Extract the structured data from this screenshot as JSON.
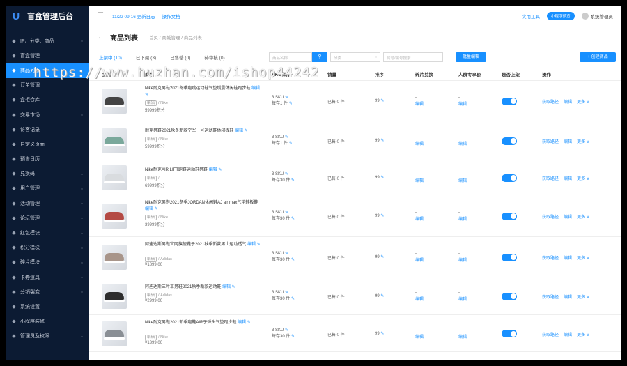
{
  "app": {
    "title": "盲盒管理后台"
  },
  "sidebar": {
    "items": [
      {
        "label": "IP、分类、商品",
        "icon": "tag-icon",
        "arrow": true
      },
      {
        "label": "盲盒管理",
        "icon": "box-icon",
        "arrow": false
      },
      {
        "label": "商品列表",
        "icon": "list-icon",
        "arrow": false,
        "active": true
      },
      {
        "label": "订单管理",
        "icon": "order-icon",
        "arrow": false
      },
      {
        "label": "盒柜仓库",
        "icon": "warehouse-icon",
        "arrow": false
      },
      {
        "label": "交易市场",
        "icon": "market-icon",
        "arrow": true
      },
      {
        "label": "访客记录",
        "icon": "visitor-icon",
        "arrow": false
      },
      {
        "label": "自定义页面",
        "icon": "page-icon",
        "arrow": false
      },
      {
        "label": "预售日历",
        "icon": "calendar-icon",
        "arrow": false
      },
      {
        "label": "兑换码",
        "icon": "code-icon",
        "arrow": true
      },
      {
        "label": "用户管理",
        "icon": "user-icon",
        "arrow": true
      },
      {
        "label": "活动管理",
        "icon": "activity-icon",
        "arrow": true
      },
      {
        "label": "论坛管理",
        "icon": "forum-icon",
        "arrow": true
      },
      {
        "label": "红包模块",
        "icon": "redpacket-icon",
        "arrow": true
      },
      {
        "label": "积分模块",
        "icon": "points-icon",
        "arrow": true
      },
      {
        "label": "碎片模块",
        "icon": "fragment-icon",
        "arrow": true
      },
      {
        "label": "卡券道具",
        "icon": "coupon-icon",
        "arrow": true
      },
      {
        "label": "分销裂变",
        "icon": "share-icon",
        "arrow": true
      },
      {
        "label": "系统设置",
        "icon": "settings-icon",
        "arrow": false
      },
      {
        "label": "小程序装修",
        "icon": "miniapp-icon",
        "arrow": false
      },
      {
        "label": "管理员及权限",
        "icon": "admin-icon",
        "arrow": true
      }
    ]
  },
  "topbar": {
    "time": "11/22 09:16 更新日志",
    "doc": "操作文档",
    "tools": "实用工具",
    "mini_program": "小程序预览",
    "user": "系统管理员"
  },
  "page": {
    "title": "商品列表",
    "breadcrumb": "首页 / 商城管理 / 商品列表"
  },
  "toolbar": {
    "tabs": [
      "上架中 (10)",
      "已下架 (3)",
      "已售罄 (0)",
      "待审核 (0)"
    ],
    "search_placeholder": "商品名称",
    "category_placeholder": "分类",
    "code_placeholder": "货号/编号搜索",
    "batch_label": "批量编辑",
    "create_label": "+ 创建商品"
  },
  "table": {
    "headers": [
      "主图",
      "商品",
      "SKU库存",
      "销量",
      "排序",
      "碎片兑换",
      "人群专享价",
      "是否上架",
      "操作"
    ],
    "rows": [
      {
        "name": "Nike耐克男鞋2021冬季跑跳运动鞋气垫缓震休闲鞋跑步鞋",
        "edit": "编辑",
        "tag": "Nike",
        "price": "59999积分",
        "sku": "3 SKU",
        "stock": "每存1 件",
        "sales": "已售 0 件",
        "sort": "99",
        "frag": "-",
        "frag_edit": "编辑",
        "pm": "-",
        "pm_edit": "编辑",
        "shoe": "#444"
      },
      {
        "name": "耐克男鞋2021秋冬新款空军一号运动鞋休闲板鞋",
        "edit": "编辑",
        "tag": "Nike",
        "price": "59999积分",
        "sku": "3 SKU",
        "stock": "每存1 件",
        "sales": "已售 0 件",
        "sort": "99",
        "frag": "-",
        "frag_edit": "编辑",
        "pm": "-",
        "pm_edit": "编辑",
        "shoe": "#7aa89b"
      },
      {
        "name": "Nike耐克AIR LIFT跑鞋运动鞋男鞋",
        "edit": "编辑",
        "tag": "",
        "price": "69999积分",
        "sku": "3 SKU",
        "stock": "每存30 件",
        "sales": "已售 0 件",
        "sort": "99",
        "frag": "-",
        "frag_edit": "编辑",
        "pm": "-",
        "pm_edit": "编辑",
        "shoe": "#d9dcdf"
      },
      {
        "name": "Nike耐克男鞋2021冬季JORDAN休闲鞋AJ air max气垫鞋板鞋",
        "edit": "编辑",
        "tag": "Nike",
        "price": "39999积分",
        "sku": "3 SKU",
        "stock": "每存30 件",
        "sales": "已售 0 件",
        "sort": "99",
        "frag": "-",
        "frag_edit": "编辑",
        "pm": "-",
        "pm_edit": "编辑",
        "shoe": "#b44a44"
      },
      {
        "name": "阿迪达斯男鞋官网旗舰鞋子2021秋季新款男士运动透气",
        "edit": "编辑",
        "tag": "Adidas",
        "price": "¥1899.00",
        "sku": "3 SKU",
        "stock": "每存30 件",
        "sales": "已售 0 件",
        "sort": "99",
        "frag": "-",
        "frag_edit": "编辑",
        "pm": "-",
        "pm_edit": "编辑",
        "shoe": "#a8958a"
      },
      {
        "name": "阿迪达斯三叶草男鞋2021秋季新款运动鞋",
        "edit": "编辑",
        "tag": "Adidas",
        "price": "¥2999.00",
        "sku": "3 SKU",
        "stock": "每存30 件",
        "sales": "已售 0 件",
        "sort": "99",
        "frag": "-",
        "frag_edit": "编辑",
        "pm": "-",
        "pm_edit": "编辑",
        "shoe": "#2d2d2d"
      },
      {
        "name": "Nike耐克男鞋2021新季跑鞋AIR子弹头气垫跑步鞋",
        "edit": "编辑",
        "tag": "Nike",
        "price": "¥1399.00",
        "sku": "3 SKU",
        "stock": "每存30 件",
        "sales": "已售 0 件",
        "sort": "99",
        "frag": "-",
        "frag_edit": "编辑",
        "pm": "-",
        "pm_edit": "编辑",
        "shoe": "#8a8f95"
      }
    ],
    "ops": [
      "获取路径",
      "编辑",
      "更多 ∨"
    ]
  },
  "watermark": "https://www.huzhan.com/ishop44242"
}
